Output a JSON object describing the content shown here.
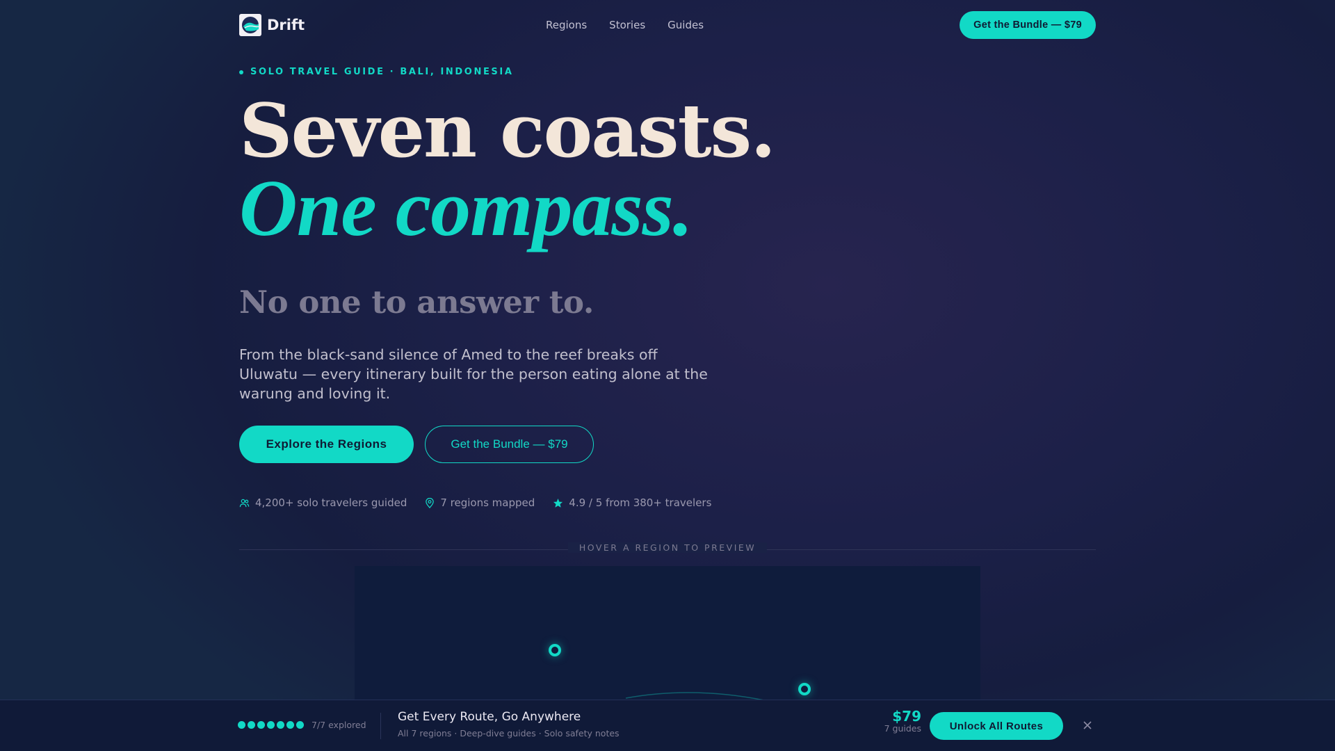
{
  "nav": {
    "brand": "Drift",
    "links": [
      "Regions",
      "Stories",
      "Guides"
    ],
    "cta": "Get the Bundle — $79"
  },
  "hero": {
    "eyebrow": "SOLO TRAVEL GUIDE · BALI, INDONESIA",
    "headline_line1": "Seven coasts.",
    "headline_line2": "One compass.",
    "subheadline": "No one to answer to.",
    "lead": "From the black-sand silence of Amed to the reef breaks off Uluwatu — every itinerary built for the person eating alone at the warung and loving it.",
    "primary_button": "Explore the Regions",
    "secondary_button": "Get the Bundle — $79"
  },
  "stats": [
    {
      "icon": "users-icon",
      "text": "4,200+ solo travelers guided"
    },
    {
      "icon": "map-pin-icon",
      "text": "7 regions mapped"
    },
    {
      "icon": "star-icon",
      "text": "4.9 / 5 from 380+ travelers"
    }
  ],
  "divider_label": "HOVER A REGION TO PREVIEW",
  "bottom_bar": {
    "progress_total": 7,
    "progress_filled": 7,
    "progress_text": "7/7 explored",
    "title": "Get Every Route, Go Anywhere",
    "subtitle": "All 7 regions · Deep-dive guides · Solo safety notes",
    "price": "$79",
    "price_sub": "7 guides",
    "cta": "Unlock All Routes"
  },
  "colors": {
    "accent": "#12d9c6",
    "headline": "#f3e6d9",
    "background": "#1c2048"
  }
}
